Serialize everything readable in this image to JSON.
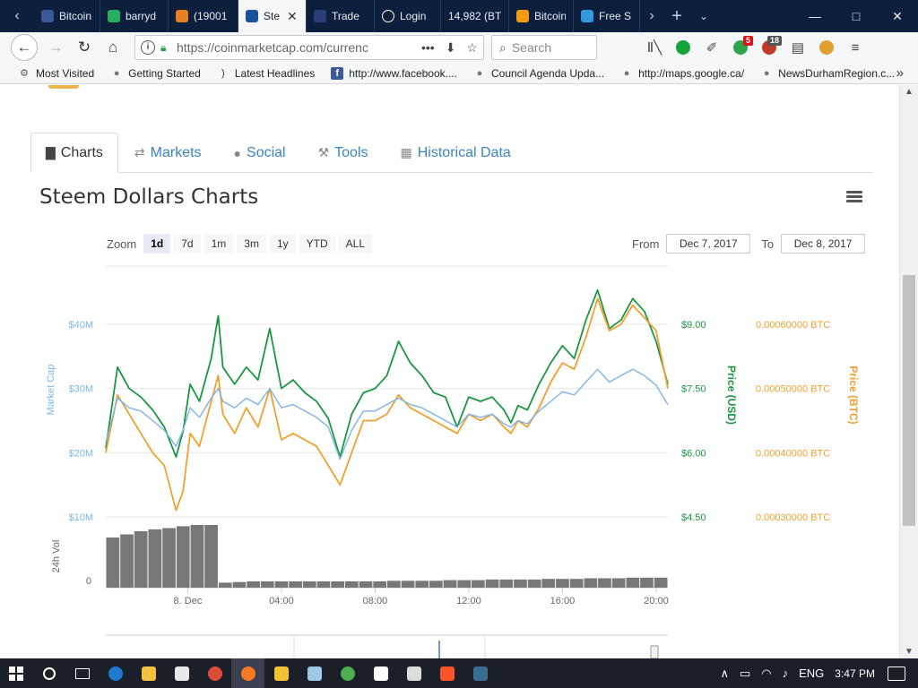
{
  "browser": {
    "tabs": [
      {
        "label": "Bitcoin",
        "color": "#3b5998"
      },
      {
        "label": "barryd",
        "color": "#27ae60"
      },
      {
        "label": "(19001",
        "color": "#e67e22"
      },
      {
        "label": "Ste",
        "color": "#1a5099",
        "active": true
      },
      {
        "label": "Trade",
        "color": "#2c3e7a"
      },
      {
        "label": "Login",
        "color": "#ffffff"
      },
      {
        "label": "14,982 (BTC",
        "color": ""
      },
      {
        "label": "Bitcoin",
        "color": "#f39c12"
      },
      {
        "label": "Free S",
        "color": "#3498db"
      }
    ],
    "url": "https://coinmarketcap.com/currenc",
    "search_placeholder": "Search",
    "badges": {
      "vpn": "5",
      "abp": "18"
    },
    "bookmarks": [
      {
        "label": "Most Visited",
        "icon": "gear-icon"
      },
      {
        "label": "Getting Started",
        "icon": "globe-icon"
      },
      {
        "label": "Latest Headlines",
        "icon": "rss-icon"
      },
      {
        "label": "http://www.facebook....",
        "icon": "facebook-icon"
      },
      {
        "label": "Council Agenda Upda...",
        "icon": "globe-icon"
      },
      {
        "label": "http://maps.google.ca/",
        "icon": "globe-icon"
      },
      {
        "label": "NewsDurhamRegion.c...",
        "icon": "globe-icon"
      }
    ]
  },
  "page": {
    "tabs": [
      {
        "label": "Charts",
        "icon": "bar-chart-icon",
        "active": true
      },
      {
        "label": "Markets",
        "icon": "exchange-icon"
      },
      {
        "label": "Social",
        "icon": "globe-icon"
      },
      {
        "label": "Tools",
        "icon": "wrench-icon"
      },
      {
        "label": "Historical Data",
        "icon": "calendar-icon"
      }
    ],
    "chart_title": "Steem Dollars Charts",
    "zoom_label": "Zoom",
    "zoom_buttons": [
      "1d",
      "7d",
      "1m",
      "3m",
      "1y",
      "YTD",
      "ALL"
    ],
    "zoom_selected": "1d",
    "from_label": "From",
    "from_date": "Dec 7, 2017",
    "to_label": "To",
    "to_date": "Dec 8, 2017"
  },
  "chart_data": {
    "type": "line",
    "colors": {
      "market_cap": "#7cb5ec",
      "price_usd": "#1a9641",
      "price_btc": "#f0a030",
      "volume": "#777777"
    },
    "axes": {
      "market_cap": {
        "label": "Market Cap",
        "ticks": [
          "$10M",
          "$20M",
          "$30M",
          "$40M"
        ],
        "range": [
          10,
          40
        ]
      },
      "price_usd": {
        "label": "Price (USD)",
        "ticks": [
          "$4.50",
          "$6.00",
          "$7.50",
          "$9.00"
        ],
        "range": [
          4.5,
          9.0
        ]
      },
      "price_btc": {
        "label": "Price (BTC)",
        "ticks": [
          "0.00030000 BTC",
          "0.00040000 BTC",
          "0.00050000 BTC",
          "0.00060000 BTC"
        ],
        "range": [
          0.0003,
          0.0006
        ]
      },
      "volume": {
        "label": "24h Vol",
        "ticks": [
          "0"
        ]
      }
    },
    "x_ticks": [
      "8. Dec",
      "04:00",
      "08:00",
      "12:00",
      "16:00",
      "20:00"
    ],
    "x_tick_pos": [
      3.5,
      7.5,
      11.5,
      15.5,
      19.5,
      23.5
    ],
    "x_range": [
      0,
      24
    ],
    "series": [
      {
        "key": "price_usd",
        "x": [
          0,
          0.5,
          1,
          1.5,
          2,
          2.5,
          3,
          3.3,
          3.6,
          4,
          4.5,
          4.8,
          5,
          5.5,
          6,
          6.5,
          7,
          7.5,
          8,
          8.5,
          9,
          9.5,
          10,
          10.5,
          11,
          11.5,
          12,
          12.5,
          13,
          13.5,
          14,
          14.5,
          15,
          15.5,
          16,
          16.5,
          17,
          17.3,
          17.6,
          18,
          18.5,
          19,
          19.5,
          20,
          20.5,
          21,
          21.5,
          22,
          22.5,
          23,
          23.5,
          24
        ],
        "values": [
          6.1,
          8.0,
          7.5,
          7.3,
          7.0,
          6.6,
          5.9,
          6.5,
          7.6,
          7.2,
          8.2,
          9.2,
          8.0,
          7.6,
          8.0,
          7.7,
          8.9,
          7.5,
          7.7,
          7.4,
          7.2,
          6.8,
          5.9,
          6.9,
          7.4,
          7.5,
          7.8,
          8.6,
          8.1,
          7.8,
          7.4,
          7.3,
          6.6,
          7.3,
          7.2,
          7.3,
          7.0,
          6.7,
          7.1,
          7.0,
          7.6,
          8.1,
          8.5,
          8.2,
          9.1,
          9.8,
          8.9,
          9.1,
          9.6,
          9.3,
          8.6,
          7.6
        ]
      },
      {
        "key": "price_btc",
        "x": [
          0,
          0.5,
          1,
          1.5,
          2,
          2.5,
          3,
          3.3,
          3.6,
          4,
          4.5,
          4.8,
          5,
          5.5,
          6,
          6.5,
          7,
          7.5,
          8,
          8.5,
          9,
          9.5,
          10,
          10.5,
          11,
          11.5,
          12,
          12.5,
          13,
          13.5,
          14,
          14.5,
          15,
          15.5,
          16,
          16.5,
          17,
          17.3,
          17.6,
          18,
          18.5,
          19,
          19.5,
          20,
          20.5,
          21,
          21.5,
          22,
          22.5,
          23,
          23.5,
          24
        ],
        "values": [
          0.0004,
          0.00049,
          0.00046,
          0.00043,
          0.0004,
          0.00038,
          0.00031,
          0.00034,
          0.00043,
          0.00041,
          0.00048,
          0.00052,
          0.00046,
          0.00043,
          0.00047,
          0.00044,
          0.0005,
          0.00042,
          0.00043,
          0.00042,
          0.00041,
          0.00038,
          0.00035,
          0.0004,
          0.00045,
          0.00045,
          0.00046,
          0.00049,
          0.00047,
          0.00046,
          0.00045,
          0.00044,
          0.00043,
          0.00046,
          0.00045,
          0.00046,
          0.00044,
          0.00043,
          0.00045,
          0.00044,
          0.00047,
          0.00051,
          0.00054,
          0.00053,
          0.00058,
          0.00064,
          0.00059,
          0.0006,
          0.00063,
          0.00061,
          0.00059,
          0.0005
        ]
      },
      {
        "key": "market_cap",
        "x": [
          0,
          0.5,
          1,
          1.5,
          2,
          2.5,
          3,
          3.3,
          3.6,
          4,
          4.5,
          4.8,
          5,
          5.5,
          6,
          6.5,
          7,
          7.5,
          8,
          8.5,
          9,
          9.5,
          10,
          10.5,
          11,
          11.5,
          12,
          12.5,
          13,
          13.5,
          14,
          14.5,
          15,
          15.5,
          16,
          16.5,
          17,
          17.3,
          17.6,
          18,
          18.5,
          19,
          19.5,
          20,
          20.5,
          21,
          21.5,
          22,
          22.5,
          23,
          23.5,
          24
        ],
        "values": [
          21.5,
          28.5,
          27.0,
          26.5,
          25.0,
          23.5,
          21.0,
          23.5,
          27.0,
          25.5,
          28.5,
          30.0,
          28.0,
          27.0,
          28.5,
          27.5,
          30.0,
          27.0,
          27.5,
          26.5,
          25.5,
          24.0,
          19.0,
          23.5,
          26.5,
          26.5,
          27.5,
          28.5,
          27.5,
          27.0,
          26.0,
          25.0,
          24.0,
          26.0,
          25.5,
          26.0,
          24.5,
          24.0,
          25.0,
          24.5,
          26.5,
          28.0,
          29.5,
          29.0,
          31.0,
          33.0,
          31.0,
          32.0,
          33.0,
          32.0,
          30.5,
          27.5
        ]
      }
    ],
    "volume_values": [
      0.8,
      0.85,
      0.9,
      0.93,
      0.95,
      0.98,
      1.0,
      1.0,
      0.08,
      0.09,
      0.1,
      0.1,
      0.1,
      0.1,
      0.1,
      0.1,
      0.1,
      0.1,
      0.1,
      0.1,
      0.11,
      0.11,
      0.11,
      0.11,
      0.12,
      0.12,
      0.12,
      0.13,
      0.13,
      0.13,
      0.13,
      0.14,
      0.14,
      0.14,
      0.15,
      0.15,
      0.15,
      0.16,
      0.16,
      0.16
    ]
  },
  "taskbar": {
    "language": "ENG",
    "time": "3:47 PM"
  }
}
